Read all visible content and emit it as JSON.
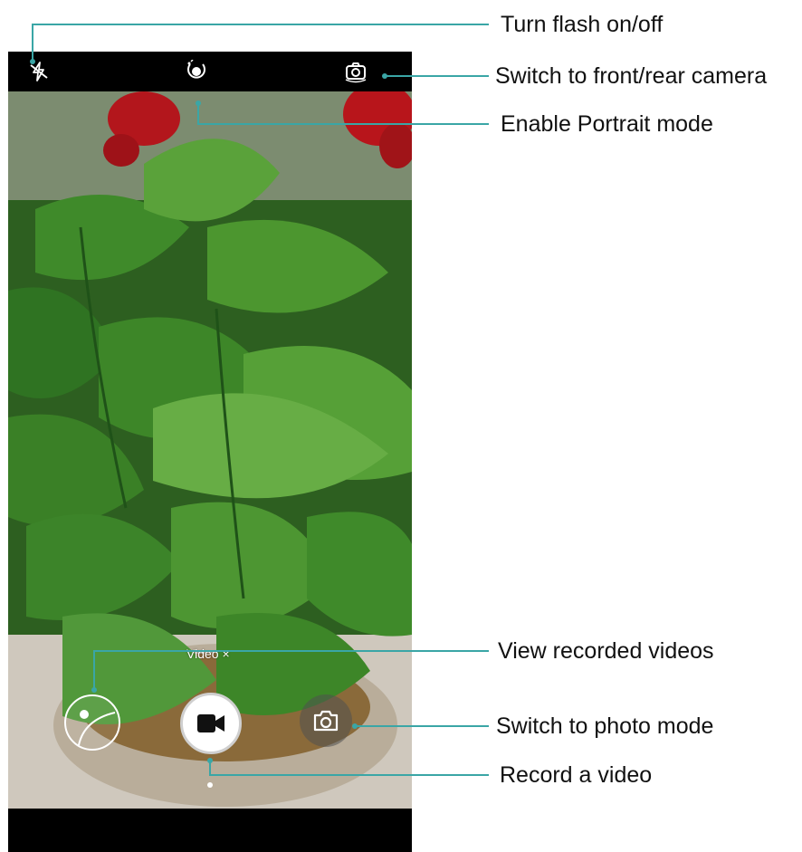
{
  "camera": {
    "topbar": {
      "flash_icon": "flash-off-icon",
      "portrait_icon": "portrait-mode-icon",
      "switch_camera_icon": "switch-camera-icon"
    },
    "mode_label": "Video",
    "mode_close": "×",
    "controls": {
      "gallery_icon": "gallery-thumbnail-icon",
      "record_icon": "video-camera-icon",
      "photo_icon": "camera-icon"
    }
  },
  "callouts": {
    "flash": "Turn flash on/off",
    "switch_camera": "Switch to front/rear camera",
    "portrait": "Enable Portrait mode",
    "view_videos": "View recorded videos",
    "photo_mode": "Switch to photo mode",
    "record": "Record a video"
  },
  "colors": {
    "callout_line": "#3aa6a6",
    "bar": "#000000"
  }
}
